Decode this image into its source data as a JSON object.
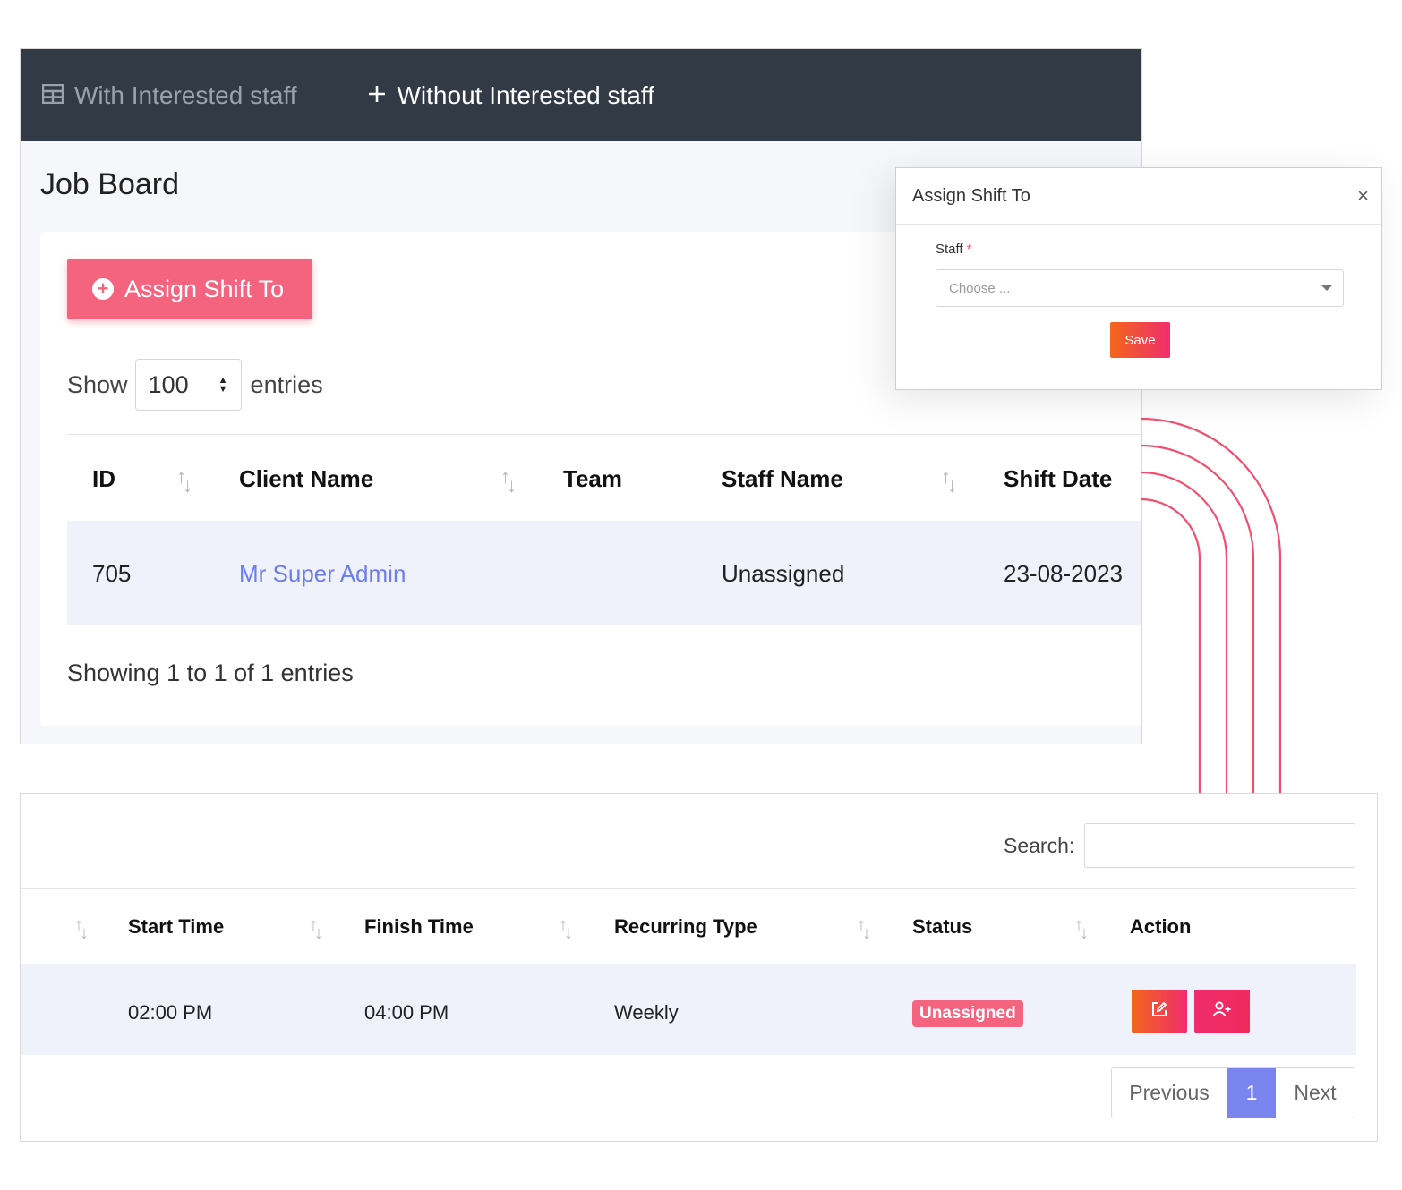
{
  "tabs": [
    {
      "label": "With Interested staff",
      "icon": "table-icon",
      "active": false
    },
    {
      "label": "Without Interested staff",
      "icon": "plus-icon",
      "active": true
    }
  ],
  "page_title": "Job Board",
  "assign_button": {
    "label": "Assign Shift To",
    "color": "#f5647f"
  },
  "length_control": {
    "prefix": "Show",
    "value": "100",
    "suffix": "entries"
  },
  "table_top": {
    "columns": [
      "ID",
      "Client Name",
      "Team",
      "Staff Name",
      "Shift Date"
    ],
    "rows": [
      {
        "id": "705",
        "client_name": "Mr Super Admin",
        "team": "",
        "staff_name": "Unassigned",
        "shift_date": "23-08-2023"
      }
    ],
    "info": "Showing 1 to 1 of 1 entries"
  },
  "modal": {
    "title": "Assign Shift To",
    "close": "×",
    "staff_label": "Staff",
    "required_mark": "*",
    "staff_placeholder": "Choose ...",
    "save_label": "Save"
  },
  "table_bottom": {
    "search_label": "Search:",
    "search_value": "",
    "columns": [
      "Start Time",
      "Finish Time",
      "Recurring Type",
      "Status",
      "Action"
    ],
    "rows": [
      {
        "start_time": "02:00 PM",
        "finish_time": "04:00 PM",
        "recurring_type": "Weekly",
        "status": "Unassigned"
      }
    ],
    "pagination": {
      "previous": "Previous",
      "current": "1",
      "next": "Next"
    }
  },
  "colors": {
    "accent": "#f5647f",
    "link": "#6c7cf2",
    "header_bg": "#323a46",
    "pager_active": "#7b85f0"
  }
}
